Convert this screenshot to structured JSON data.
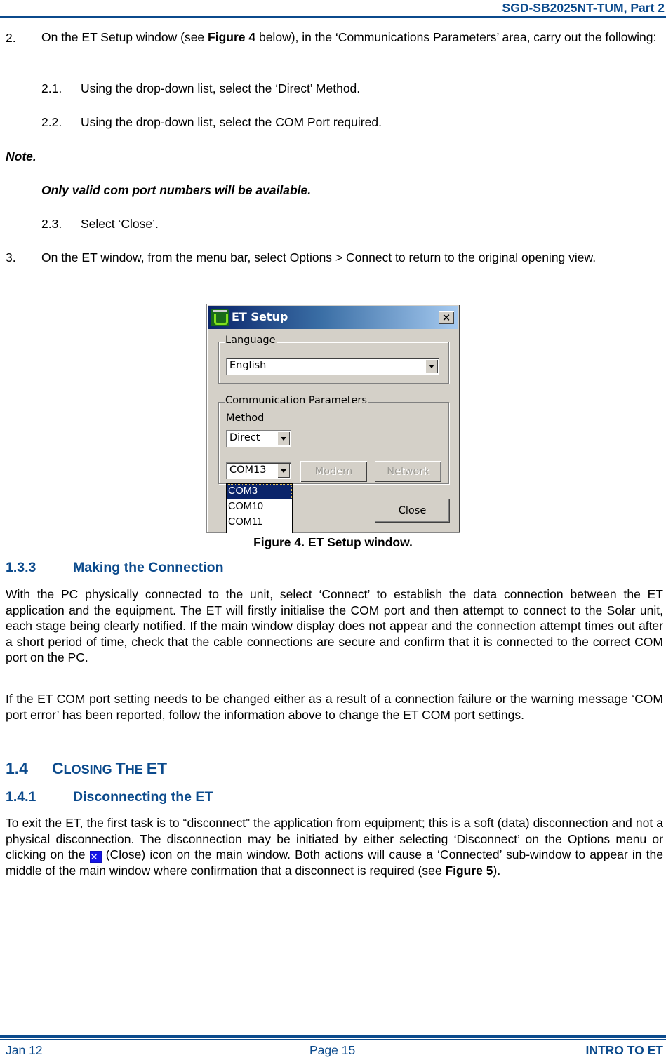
{
  "header": {
    "doc_id": "SGD-SB2025NT-TUM, Part 2"
  },
  "steps": {
    "step2": {
      "number": "2.",
      "pre": "On the ET Setup window (see ",
      "ref": "Figure 4",
      "post": " below), in the ‘Communications Parameters’ area, carry out the following:"
    },
    "step2_1": {
      "number": "2.1.",
      "text": "Using the drop-down list, select the ‘Direct’ Method."
    },
    "step2_2": {
      "number": "2.2.",
      "text": "Using the drop-down list, select the COM Port required."
    },
    "note_label": "Note.",
    "note_text": "Only valid com port numbers will be available.",
    "step2_3": {
      "number": "2.3.",
      "text": "Select ‘Close’."
    },
    "step3": {
      "number": "3.",
      "text": "On the ET window, from the menu bar, select Options > Connect to return to the original opening view."
    }
  },
  "dialog": {
    "title": "ET Setup",
    "close_glyph": "✕",
    "language_group": "Language",
    "language_value": "English",
    "comm_group": "Communication Parameters",
    "method_label": "Method",
    "method_value": "Direct",
    "port_value": "COM13",
    "modem_button": "Modem",
    "network_button": "Network",
    "close_button": "Close",
    "port_options": [
      "COM3",
      "COM10",
      "COM11"
    ],
    "selected_port_option": "COM3"
  },
  "figure_caption": "Figure 4.  ET Setup window.",
  "section_133": {
    "number": "1.3.3",
    "title": "Making the Connection",
    "para1": "With the PC physically connected to the unit, select ‘Connect’ to establish the data connection between the ET application and the equipment.  The ET will firstly initialise the COM port and then attempt to connect to the Solar unit, each stage being clearly notified.  If the main window display does not appear and the connection attempt times out after a short period of time, check that the cable connections are secure and confirm that it is connected to the correct COM port on the PC.",
    "para2": "If the ET COM port setting needs to be changed either as a result of a connection failure or the warning message ‘COM port error’ has been reported, follow the information above to change the ET COM port settings."
  },
  "section_14": {
    "number": "1.4",
    "title_parts": [
      "C",
      "LOSING ",
      "T",
      "HE ",
      "ET"
    ]
  },
  "section_141": {
    "number": "1.4.1",
    "title": "Disconnecting the ET",
    "para_pre": "To exit the ET, the first task is to “disconnect” the application from equipment; this is a soft (data) disconnection and not a physical disconnection.  The disconnection may be initiated by either selecting ‘Disconnect’ on the Options menu or clicking on the ",
    "close_icon_glyph": "✕",
    "para_post": " (Close) icon on the main window.  Both actions will cause a ‘Connected’ sub-window to appear in the middle of the main window where confirmation that a disconnect is required (see ",
    "para_ref": "Figure 5",
    "para_end": ")."
  },
  "footer": {
    "date": "Jan 12",
    "page": "Page 15",
    "section": "INTRO TO ET"
  },
  "colors": {
    "brand_blue": "#0b4a8c",
    "close_icon_blue": "#1515e8",
    "selection_navy": "#0a246a"
  }
}
